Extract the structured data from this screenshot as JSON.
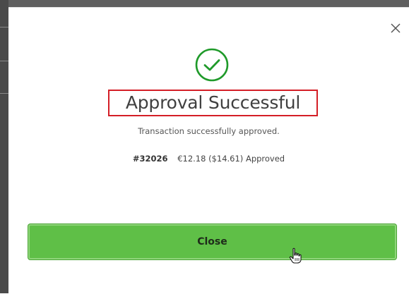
{
  "dialog": {
    "close_icon": "close-icon",
    "status_icon": "check-circle-icon",
    "title": "Approval Successful",
    "subtitle": "Transaction successfully approved.",
    "transaction": {
      "id": "#32026",
      "details": "€12.18 ($14.61) Approved"
    },
    "close_button_label": "Close"
  },
  "colors": {
    "success_green": "#1f9a2a",
    "button_green": "#5fbf47",
    "highlight_red": "#d41e26"
  }
}
